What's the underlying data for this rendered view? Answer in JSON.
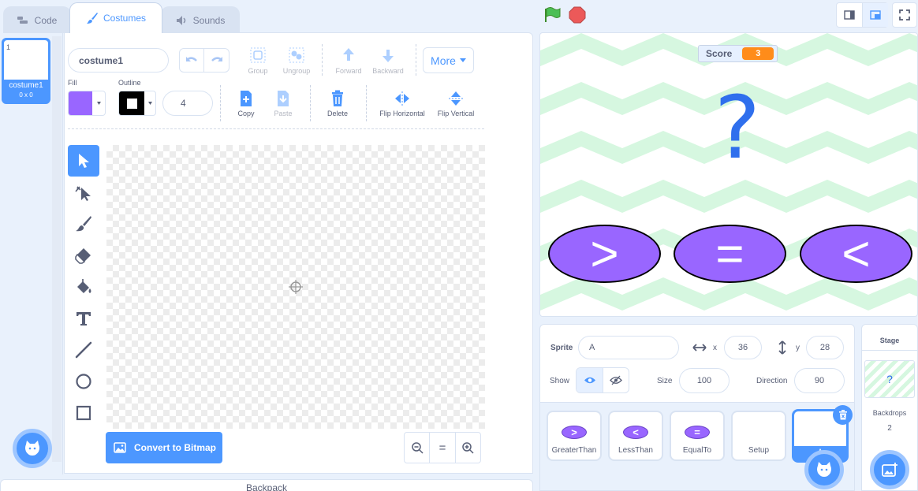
{
  "tabs": {
    "code": "Code",
    "costumes": "Costumes",
    "sounds": "Sounds"
  },
  "costume_list": [
    {
      "number": "1",
      "name": "costume1",
      "size": "0 x 0"
    }
  ],
  "editor": {
    "costume_name": "costume1",
    "group": "Group",
    "ungroup": "Ungroup",
    "forward": "Forward",
    "backward": "Backward",
    "more": "More",
    "fill_label": "Fill",
    "outline_label": "Outline",
    "outline_width": "4",
    "copy": "Copy",
    "paste": "Paste",
    "delete": "Delete",
    "flip_h": "Flip Horizontal",
    "flip_v": "Flip Vertical",
    "convert_button": "Convert to Bitmap",
    "zoom_reset": "="
  },
  "colors": {
    "accent": "#4c97ff",
    "fill_color": "#9966ff",
    "outline_color": "#000000",
    "score_value_bg": "#ff8c1a"
  },
  "backpack": "Backpack",
  "stage": {
    "score_label": "Score",
    "score_value": "3",
    "question": "?",
    "answer_greater": ">",
    "answer_equal": "=",
    "answer_less": "<"
  },
  "sprite_info": {
    "sprite_label": "Sprite",
    "sprite_name": "A",
    "x_label": "x",
    "x_value": "36",
    "y_label": "y",
    "y_value": "28",
    "show_label": "Show",
    "size_label": "Size",
    "size_value": "100",
    "direction_label": "Direction",
    "direction_value": "90"
  },
  "sprites": [
    {
      "name": "GreaterThan",
      "symbol": ">"
    },
    {
      "name": "LessThan",
      "symbol": "<"
    },
    {
      "name": "EqualTo",
      "symbol": "="
    },
    {
      "name": "Setup"
    },
    {
      "name": "A"
    }
  ],
  "stage_panel": {
    "title": "Stage",
    "backdrops_label": "Backdrops",
    "backdrops_count": "2",
    "thumb_symbol": "?"
  }
}
